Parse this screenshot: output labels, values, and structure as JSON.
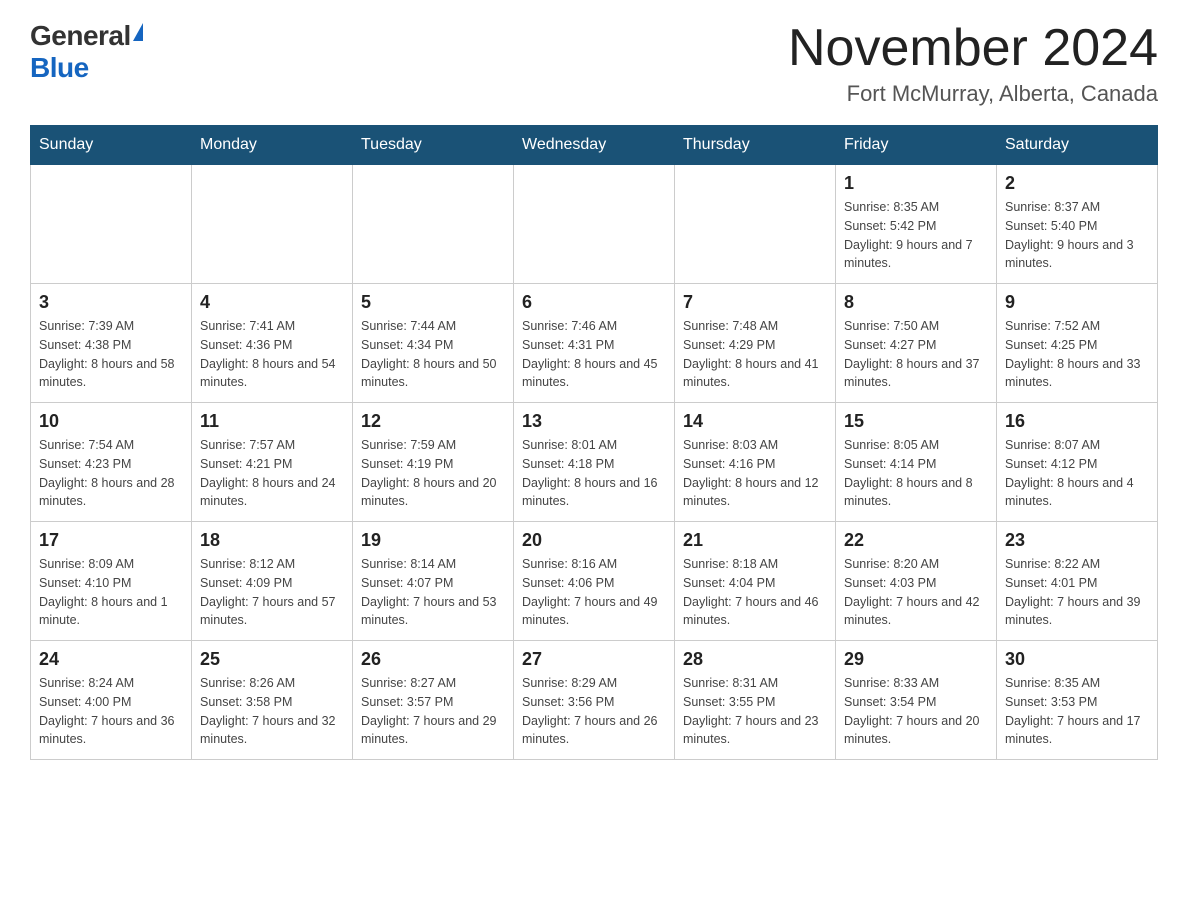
{
  "header": {
    "logo_general": "General",
    "logo_blue": "Blue",
    "calendar_title": "November 2024",
    "calendar_subtitle": "Fort McMurray, Alberta, Canada"
  },
  "days_of_week": [
    "Sunday",
    "Monday",
    "Tuesday",
    "Wednesday",
    "Thursday",
    "Friday",
    "Saturday"
  ],
  "weeks": [
    {
      "days": [
        {
          "number": "",
          "info": ""
        },
        {
          "number": "",
          "info": ""
        },
        {
          "number": "",
          "info": ""
        },
        {
          "number": "",
          "info": ""
        },
        {
          "number": "",
          "info": ""
        },
        {
          "number": "1",
          "info": "Sunrise: 8:35 AM\nSunset: 5:42 PM\nDaylight: 9 hours and 7 minutes."
        },
        {
          "number": "2",
          "info": "Sunrise: 8:37 AM\nSunset: 5:40 PM\nDaylight: 9 hours and 3 minutes."
        }
      ]
    },
    {
      "days": [
        {
          "number": "3",
          "info": "Sunrise: 7:39 AM\nSunset: 4:38 PM\nDaylight: 8 hours and 58 minutes."
        },
        {
          "number": "4",
          "info": "Sunrise: 7:41 AM\nSunset: 4:36 PM\nDaylight: 8 hours and 54 minutes."
        },
        {
          "number": "5",
          "info": "Sunrise: 7:44 AM\nSunset: 4:34 PM\nDaylight: 8 hours and 50 minutes."
        },
        {
          "number": "6",
          "info": "Sunrise: 7:46 AM\nSunset: 4:31 PM\nDaylight: 8 hours and 45 minutes."
        },
        {
          "number": "7",
          "info": "Sunrise: 7:48 AM\nSunset: 4:29 PM\nDaylight: 8 hours and 41 minutes."
        },
        {
          "number": "8",
          "info": "Sunrise: 7:50 AM\nSunset: 4:27 PM\nDaylight: 8 hours and 37 minutes."
        },
        {
          "number": "9",
          "info": "Sunrise: 7:52 AM\nSunset: 4:25 PM\nDaylight: 8 hours and 33 minutes."
        }
      ]
    },
    {
      "days": [
        {
          "number": "10",
          "info": "Sunrise: 7:54 AM\nSunset: 4:23 PM\nDaylight: 8 hours and 28 minutes."
        },
        {
          "number": "11",
          "info": "Sunrise: 7:57 AM\nSunset: 4:21 PM\nDaylight: 8 hours and 24 minutes."
        },
        {
          "number": "12",
          "info": "Sunrise: 7:59 AM\nSunset: 4:19 PM\nDaylight: 8 hours and 20 minutes."
        },
        {
          "number": "13",
          "info": "Sunrise: 8:01 AM\nSunset: 4:18 PM\nDaylight: 8 hours and 16 minutes."
        },
        {
          "number": "14",
          "info": "Sunrise: 8:03 AM\nSunset: 4:16 PM\nDaylight: 8 hours and 12 minutes."
        },
        {
          "number": "15",
          "info": "Sunrise: 8:05 AM\nSunset: 4:14 PM\nDaylight: 8 hours and 8 minutes."
        },
        {
          "number": "16",
          "info": "Sunrise: 8:07 AM\nSunset: 4:12 PM\nDaylight: 8 hours and 4 minutes."
        }
      ]
    },
    {
      "days": [
        {
          "number": "17",
          "info": "Sunrise: 8:09 AM\nSunset: 4:10 PM\nDaylight: 8 hours and 1 minute."
        },
        {
          "number": "18",
          "info": "Sunrise: 8:12 AM\nSunset: 4:09 PM\nDaylight: 7 hours and 57 minutes."
        },
        {
          "number": "19",
          "info": "Sunrise: 8:14 AM\nSunset: 4:07 PM\nDaylight: 7 hours and 53 minutes."
        },
        {
          "number": "20",
          "info": "Sunrise: 8:16 AM\nSunset: 4:06 PM\nDaylight: 7 hours and 49 minutes."
        },
        {
          "number": "21",
          "info": "Sunrise: 8:18 AM\nSunset: 4:04 PM\nDaylight: 7 hours and 46 minutes."
        },
        {
          "number": "22",
          "info": "Sunrise: 8:20 AM\nSunset: 4:03 PM\nDaylight: 7 hours and 42 minutes."
        },
        {
          "number": "23",
          "info": "Sunrise: 8:22 AM\nSunset: 4:01 PM\nDaylight: 7 hours and 39 minutes."
        }
      ]
    },
    {
      "days": [
        {
          "number": "24",
          "info": "Sunrise: 8:24 AM\nSunset: 4:00 PM\nDaylight: 7 hours and 36 minutes."
        },
        {
          "number": "25",
          "info": "Sunrise: 8:26 AM\nSunset: 3:58 PM\nDaylight: 7 hours and 32 minutes."
        },
        {
          "number": "26",
          "info": "Sunrise: 8:27 AM\nSunset: 3:57 PM\nDaylight: 7 hours and 29 minutes."
        },
        {
          "number": "27",
          "info": "Sunrise: 8:29 AM\nSunset: 3:56 PM\nDaylight: 7 hours and 26 minutes."
        },
        {
          "number": "28",
          "info": "Sunrise: 8:31 AM\nSunset: 3:55 PM\nDaylight: 7 hours and 23 minutes."
        },
        {
          "number": "29",
          "info": "Sunrise: 8:33 AM\nSunset: 3:54 PM\nDaylight: 7 hours and 20 minutes."
        },
        {
          "number": "30",
          "info": "Sunrise: 8:35 AM\nSunset: 3:53 PM\nDaylight: 7 hours and 17 minutes."
        }
      ]
    }
  ]
}
